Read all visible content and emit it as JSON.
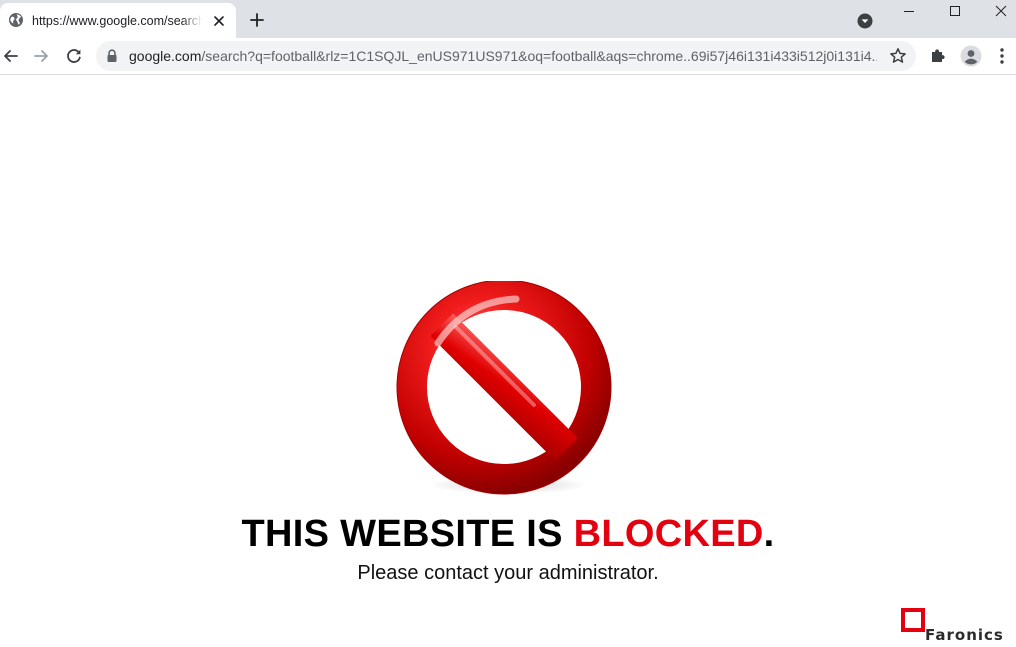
{
  "browser": {
    "tab": {
      "title": "https://www.google.com/search?q=football"
    },
    "address_bar": {
      "host": "google.com",
      "path": "/search?q=football&rlz=1C1SQJL_enUS971US971&oq=football&aqs=chrome..69i57j46i131i433i512j0i131i4..."
    }
  },
  "page": {
    "headline_prefix": "THIS WEBSITE IS ",
    "headline_highlight": "BLOCKED",
    "headline_suffix": ".",
    "subline": "Please contact your administrator.",
    "brand": "Faronics"
  },
  "colors": {
    "block_red": "#e3000f",
    "tabstrip_bg": "#dee1e6",
    "omnibox_bg": "#f1f3f4"
  },
  "icons": {
    "tab_favicon": "globe-icon",
    "tab_close": "close-icon",
    "new_tab": "plus-icon",
    "tab_search": "chevron-down-circle-icon",
    "back": "arrow-left-icon",
    "forward": "arrow-right-icon",
    "reload": "reload-icon",
    "secure": "lock-icon",
    "bookmark": "star-icon",
    "extensions": "puzzle-icon",
    "profile": "profile-icon",
    "menu": "kebab-menu-icon",
    "block": "no-entry-icon"
  }
}
